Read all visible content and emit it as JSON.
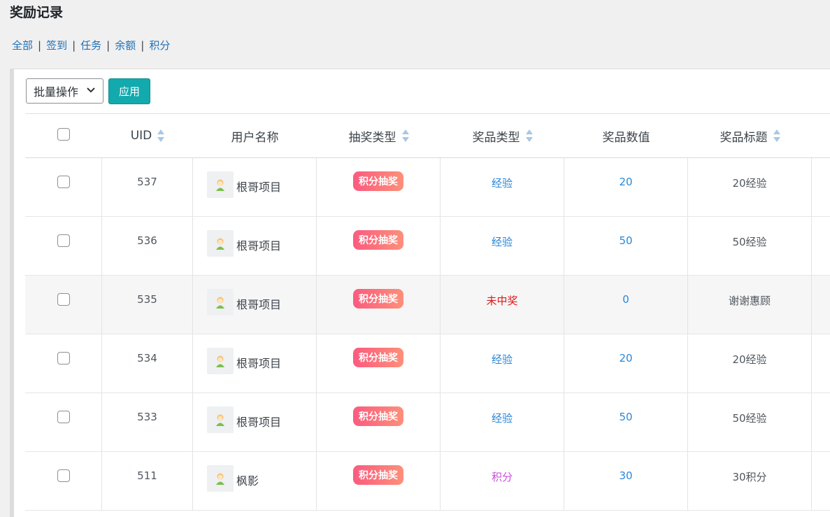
{
  "page": {
    "title": "奖励记录"
  },
  "filters": [
    {
      "label": "全部"
    },
    {
      "label": "签到"
    },
    {
      "label": "任务"
    },
    {
      "label": "余额"
    },
    {
      "label": "积分"
    }
  ],
  "toolbar": {
    "bulk_label": "批量操作",
    "apply_label": "应用"
  },
  "columns": {
    "uid": "UID",
    "username": "用户名称",
    "draw_type": "抽奖类型",
    "prize_type": "奖品类型",
    "prize_value": "奖品数值",
    "prize_title": "奖品标题"
  },
  "rows": [
    {
      "uid": "537",
      "username": "根哥项目",
      "draw_type": "积分抽奖",
      "prize_type": "经验",
      "prize_value": "20",
      "prize_title": "20经验"
    },
    {
      "uid": "536",
      "username": "根哥项目",
      "draw_type": "积分抽奖",
      "prize_type": "经验",
      "prize_value": "50",
      "prize_title": "50经验"
    },
    {
      "uid": "535",
      "username": "根哥项目",
      "draw_type": "积分抽奖",
      "prize_type": "未中奖",
      "prize_value": "0",
      "prize_title": "谢谢惠顾"
    },
    {
      "uid": "534",
      "username": "根哥项目",
      "draw_type": "积分抽奖",
      "prize_type": "经验",
      "prize_value": "20",
      "prize_title": "20经验"
    },
    {
      "uid": "533",
      "username": "根哥项目",
      "draw_type": "积分抽奖",
      "prize_type": "经验",
      "prize_value": "50",
      "prize_title": "50经验"
    },
    {
      "uid": "511",
      "username": "枫影",
      "draw_type": "积分抽奖",
      "prize_type": "积分",
      "prize_value": "30",
      "prize_title": "30积分"
    }
  ],
  "colors": {
    "link": "#2271b1",
    "apply_button": "#13aaad",
    "badge_gradient_start": "#fb5b7e",
    "badge_gradient_end": "#fd8f7a",
    "exp": "#2a87d8",
    "no_prize": "#e0161a",
    "points": "#c94fd8"
  },
  "icons": {
    "sort": "sort-arrows-icon",
    "dropdown": "chevron-down-icon",
    "avatar": "user-avatar-icon"
  }
}
